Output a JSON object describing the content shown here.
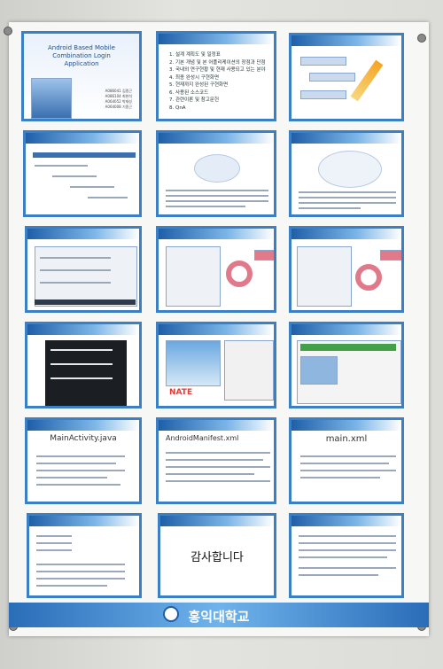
{
  "poster": {
    "title_lines": [
      "Android Based Mobile",
      "Combination Login",
      "Application"
    ],
    "authors": [
      "A086041 김종근",
      "A086104 최현석",
      "A064052 박재성",
      "A064008 기종근"
    ],
    "toc": [
      "1. 설계 계획도 및 일정표",
      "2. 기본 개념 및 본 어플리케이션의 장점과 단점",
      "3. 국내외 연구현황 및 현재 사용되고 있는 분야",
      "4. 최종 완성시 구현화면",
      "5. 현재까지 완성된 구현화면",
      "6. 사용된 소스코드",
      "7. 관련이론 및 참고문헌",
      "8. QnA"
    ],
    "main_activity": "MainActivity.java",
    "manifest": "AndroidManifest.xml",
    "main_xml": "main.xml",
    "thanks": "감사합니다",
    "nate": "NATE",
    "footer": "홍익대학교"
  }
}
